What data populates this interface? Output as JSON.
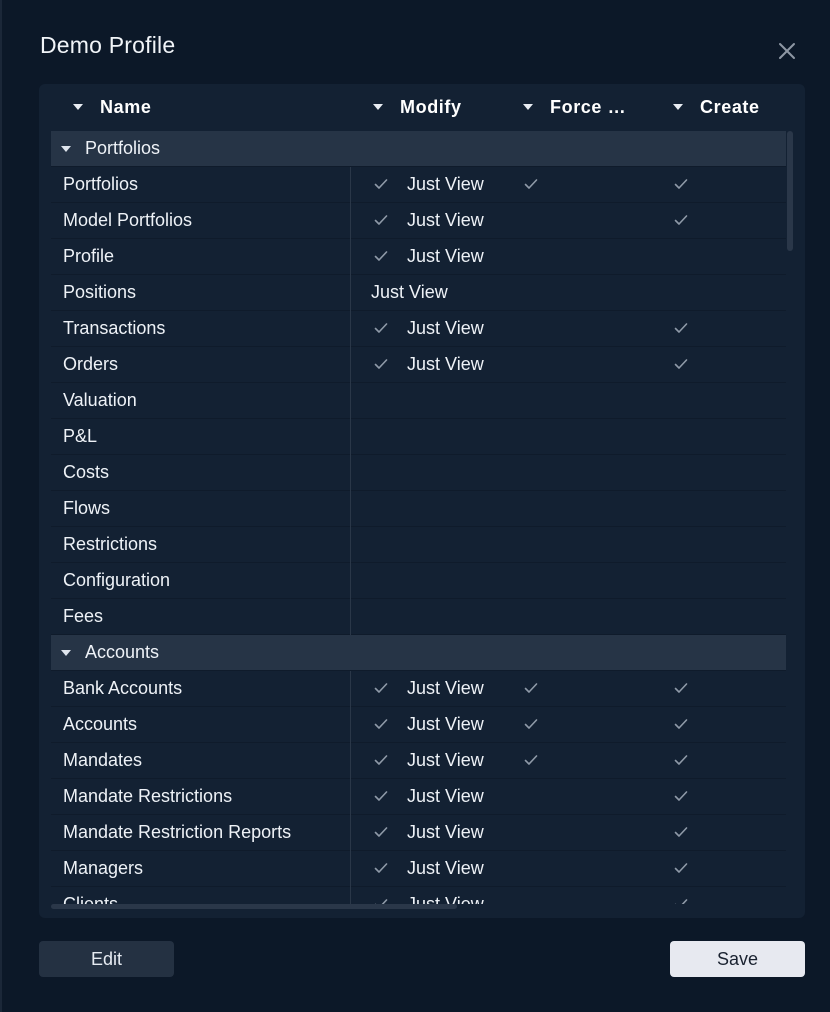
{
  "dialog": {
    "title": "Demo Profile",
    "edit_label": "Edit",
    "save_label": "Save"
  },
  "columns": {
    "name": "Name",
    "modify": "Modify",
    "force": "Force …",
    "create": "Create"
  },
  "groups": [
    {
      "label": "Portfolios",
      "rows": [
        {
          "name": "Portfolios",
          "modify_check": true,
          "modify": "Just View",
          "force": true,
          "create": true
        },
        {
          "name": "Model Portfolios",
          "modify_check": true,
          "modify": "Just View",
          "force": false,
          "create": true
        },
        {
          "name": "Profile",
          "modify_check": true,
          "modify": "Just View",
          "force": false,
          "create": false
        },
        {
          "name": "Positions",
          "modify_check": false,
          "modify": "Just View",
          "force": false,
          "create": false
        },
        {
          "name": "Transactions",
          "modify_check": true,
          "modify": "Just View",
          "force": false,
          "create": true
        },
        {
          "name": "Orders",
          "modify_check": true,
          "modify": "Just View",
          "force": false,
          "create": true
        },
        {
          "name": "Valuation",
          "modify_check": false,
          "modify": "",
          "force": false,
          "create": false
        },
        {
          "name": "P&L",
          "modify_check": false,
          "modify": "",
          "force": false,
          "create": false
        },
        {
          "name": "Costs",
          "modify_check": false,
          "modify": "",
          "force": false,
          "create": false
        },
        {
          "name": "Flows",
          "modify_check": false,
          "modify": "",
          "force": false,
          "create": false
        },
        {
          "name": "Restrictions",
          "modify_check": false,
          "modify": "",
          "force": false,
          "create": false
        },
        {
          "name": "Configuration",
          "modify_check": false,
          "modify": "",
          "force": false,
          "create": false
        },
        {
          "name": "Fees",
          "modify_check": false,
          "modify": "",
          "force": false,
          "create": false
        }
      ]
    },
    {
      "label": "Accounts",
      "rows": [
        {
          "name": "Bank Accounts",
          "modify_check": true,
          "modify": "Just View",
          "force": true,
          "create": true
        },
        {
          "name": "Accounts",
          "modify_check": true,
          "modify": "Just View",
          "force": true,
          "create": true
        },
        {
          "name": "Mandates",
          "modify_check": true,
          "modify": "Just View",
          "force": true,
          "create": true
        },
        {
          "name": "Mandate Restrictions",
          "modify_check": true,
          "modify": "Just View",
          "force": false,
          "create": true
        },
        {
          "name": "Mandate Restriction Reports",
          "modify_check": true,
          "modify": "Just View",
          "force": false,
          "create": true
        },
        {
          "name": "Managers",
          "modify_check": true,
          "modify": "Just View",
          "force": false,
          "create": true
        },
        {
          "name": "Clients",
          "modify_check": true,
          "modify": "Just View",
          "force": false,
          "create": true
        }
      ]
    }
  ],
  "icons": {
    "close": "close-icon",
    "check": "check-icon",
    "sort": "sort-caret-icon",
    "expand": "chevron-down-icon"
  },
  "colors": {
    "background": "#0c1828",
    "panel": "#132133",
    "group_row": "#263446",
    "check": "#8f9aa8",
    "save_button": "#e7e9f0"
  }
}
